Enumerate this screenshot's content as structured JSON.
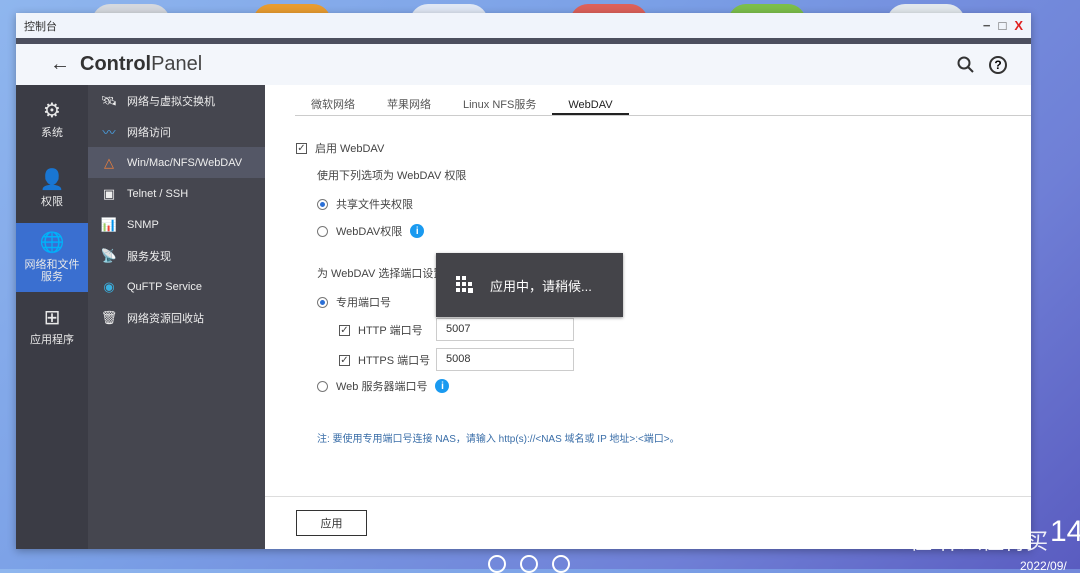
{
  "window": {
    "title": "控制台",
    "min": "−",
    "max": "□",
    "close": "X"
  },
  "header": {
    "back": "←",
    "title_bold": "Control",
    "title_light": "Panel"
  },
  "nav1": [
    {
      "icon": "⚙",
      "label": "系统"
    },
    {
      "icon": "👤",
      "label": "权限"
    },
    {
      "icon": "🌐",
      "label": "网络和文件服务"
    },
    {
      "icon": "⊞",
      "label": "应用程序"
    }
  ],
  "nav2": [
    {
      "icon": "🛰",
      "label": "网络与虚拟交换机"
    },
    {
      "icon": "〰",
      "label": "网络访问"
    },
    {
      "icon": "△",
      "label": "Win/Mac/NFS/WebDAV"
    },
    {
      "icon": "▣",
      "label": "Telnet / SSH"
    },
    {
      "icon": "📊",
      "label": "SNMP"
    },
    {
      "icon": "📡",
      "label": "服务发现"
    },
    {
      "icon": "◉",
      "label": "QuFTP Service"
    },
    {
      "icon": "🗑",
      "label": "网络资源回收站"
    }
  ],
  "tabs": [
    "微软网络",
    "苹果网络",
    "Linux NFS服务",
    "WebDAV"
  ],
  "form": {
    "enable": "启用 WebDAV",
    "perm_title": "使用下列选项为 WebDAV 权限",
    "perm_share": "共享文件夹权限",
    "perm_webdav": "WebDAV权限",
    "port_title": "为 WebDAV 选择端口设置",
    "port_dedicated": "专用端口号",
    "http_label": "HTTP 端口号",
    "http_value": "5007",
    "https_label": "HTTPS 端口号",
    "https_value": "5008",
    "port_web": "Web 服务器端口号",
    "note": "注: 要使用专用端口号连接 NAS，请输入 http(s)://<NAS 域名或 IP 地址>:<端口>。",
    "info": "i"
  },
  "apply": "应用",
  "toast": "应用中，请稍候...",
  "desktop": {
    "watermark": "值 什么值得买",
    "date": "2022/09/",
    "clock": "14"
  }
}
